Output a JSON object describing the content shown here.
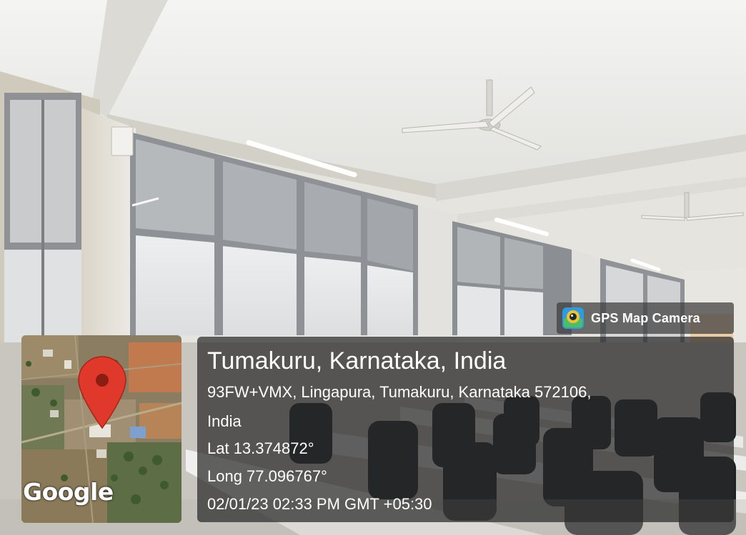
{
  "overlay": {
    "app_badge": {
      "name": "GPS Map Camera",
      "icon": "gps-map-camera-app-icon"
    },
    "map_thumbnail": {
      "brand": "Google",
      "marker_icon": "map-pin-icon",
      "marker_color": "#e0392b"
    },
    "location": {
      "title": "Tumakuru, Karnataka, India",
      "address_line_1": "93FW+VMX, Lingapura, Tumakuru, Karnataka 572106,",
      "address_line_2": "India",
      "latitude": "Lat 13.374872°",
      "longitude": "Long 77.096767°",
      "timestamp": "02/01/23 02:33 PM GMT +05:30"
    }
  },
  "colors": {
    "panel_background": "#282828",
    "text": "#ffffff"
  }
}
